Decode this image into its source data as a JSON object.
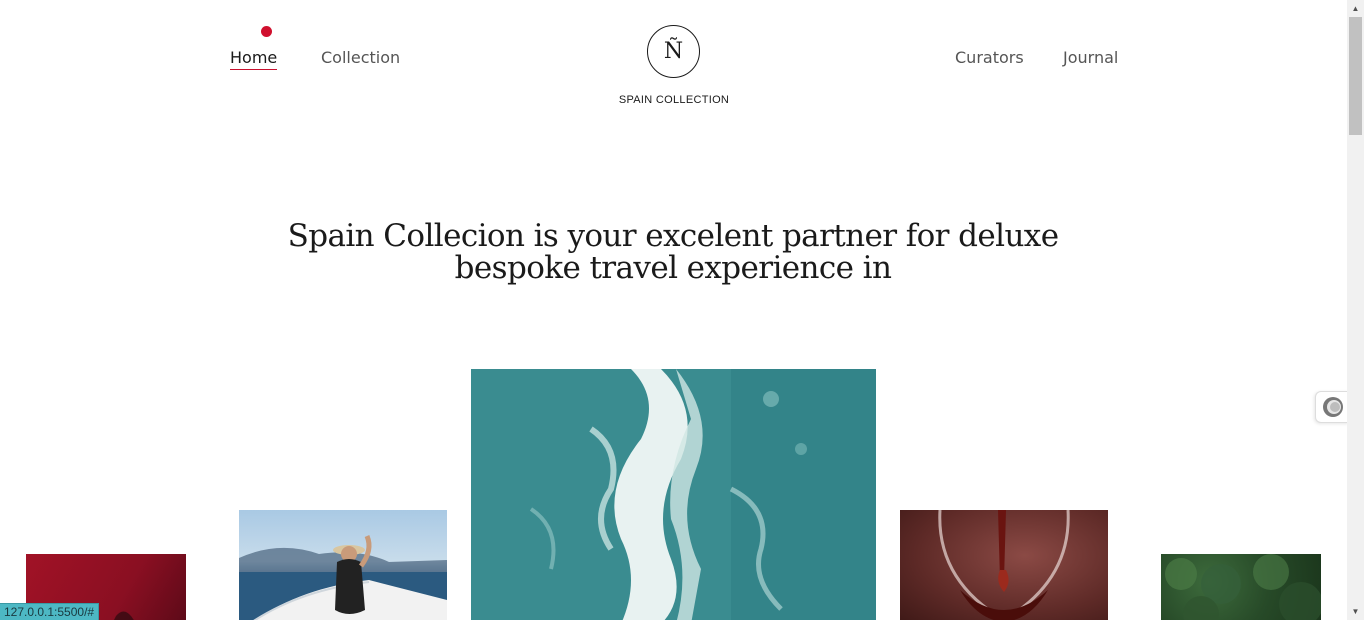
{
  "nav": {
    "home": "Home",
    "collection": "Collection",
    "curators": "Curators",
    "journal": "Journal"
  },
  "logo": {
    "mark": "Ñ",
    "text": "SPAIN COLLECTION"
  },
  "hero": {
    "title": "Spain Collecion is your excelent partner for deluxe bespoke travel experience in"
  },
  "gallery": {
    "items": [
      "red",
      "boat",
      "ocean",
      "wine",
      "forest"
    ]
  },
  "status_bar": {
    "url": "127.0.0.1:5500/#"
  },
  "colors": {
    "accent": "#d0102e",
    "status_bar": "#4db8c4"
  }
}
